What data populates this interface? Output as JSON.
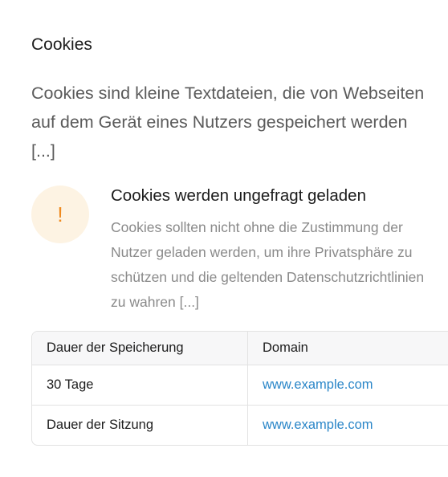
{
  "section": {
    "title": "Cookies",
    "intro": "Cookies sind kleine Textdateien, die von Webseiten auf dem Gerät eines Nutzers gespeichert werden [...]"
  },
  "alert": {
    "icon": "warning-icon",
    "icon_glyph": "!",
    "title": "Cookies werden ungefragt geladen",
    "text": "Cookies sollten nicht ohne die Zustimmung der Nutzer geladen werden, um ihre Privatsphäre zu schützen und die geltenden Datenschutzrichtlinien zu wahren [...]",
    "accent_color": "#ef8a1f",
    "icon_bg_color": "#fdf3e3"
  },
  "table": {
    "headers": [
      "Dauer der Speicherung",
      "Domain"
    ],
    "rows": [
      {
        "duration": "30 Tage",
        "domain": "www.example.com"
      },
      {
        "duration": "Dauer der Sitzung",
        "domain": "www.example.com"
      }
    ],
    "link_color": "#2a86c8"
  }
}
